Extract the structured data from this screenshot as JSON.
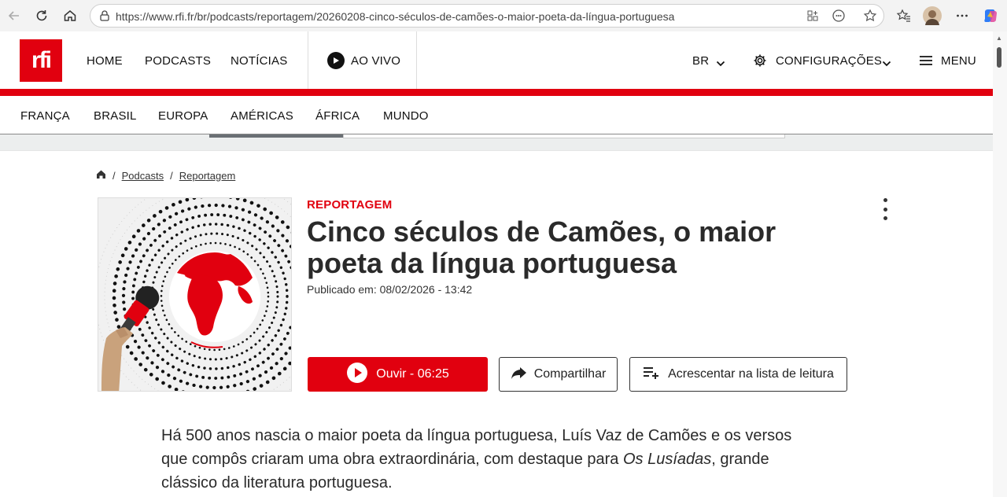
{
  "browser": {
    "url": "https://www.rfi.fr/br/podcasts/reportagem/20260208-cinco-séculos-de-camões-o-maior-poeta-da-língua-portuguesa"
  },
  "site": {
    "logo_text": "rfi",
    "nav": {
      "home": "HOME",
      "podcasts": "PODCASTS",
      "noticias": "NOTÍCIAS",
      "live": "AO VIVO",
      "lang": "BR",
      "settings": "CONFIGURAÇÕES",
      "menu": "MENU"
    },
    "subnav": [
      "FRANÇA",
      "BRASIL",
      "EUROPA",
      "AMÉRICAS",
      "ÁFRICA",
      "MUNDO"
    ],
    "accent_color": "#e1000f"
  },
  "breadcrumb": {
    "sep": "/",
    "items": [
      "Podcasts",
      "Reportagem"
    ]
  },
  "article": {
    "category": "REPORTAGEM",
    "title": "Cinco séculos de Camões, o maior poeta da língua portuguesa",
    "published": "Publicado em: 08/02/2026 - 13:42",
    "play_label": "Ouvir - 06:25",
    "share_label": "Compartilhar",
    "list_label": "Acrescentar na lista de leitura",
    "lead_1": "Há 500 anos nascia o maior poeta da língua portuguesa, Luís Vaz de Camões e os versos que compôs criaram uma obra extraordinária, com destaque para ",
    "lead_italic": "Os Lusíadas",
    "lead_2": ", grande clássico da literatura portuguesa."
  }
}
